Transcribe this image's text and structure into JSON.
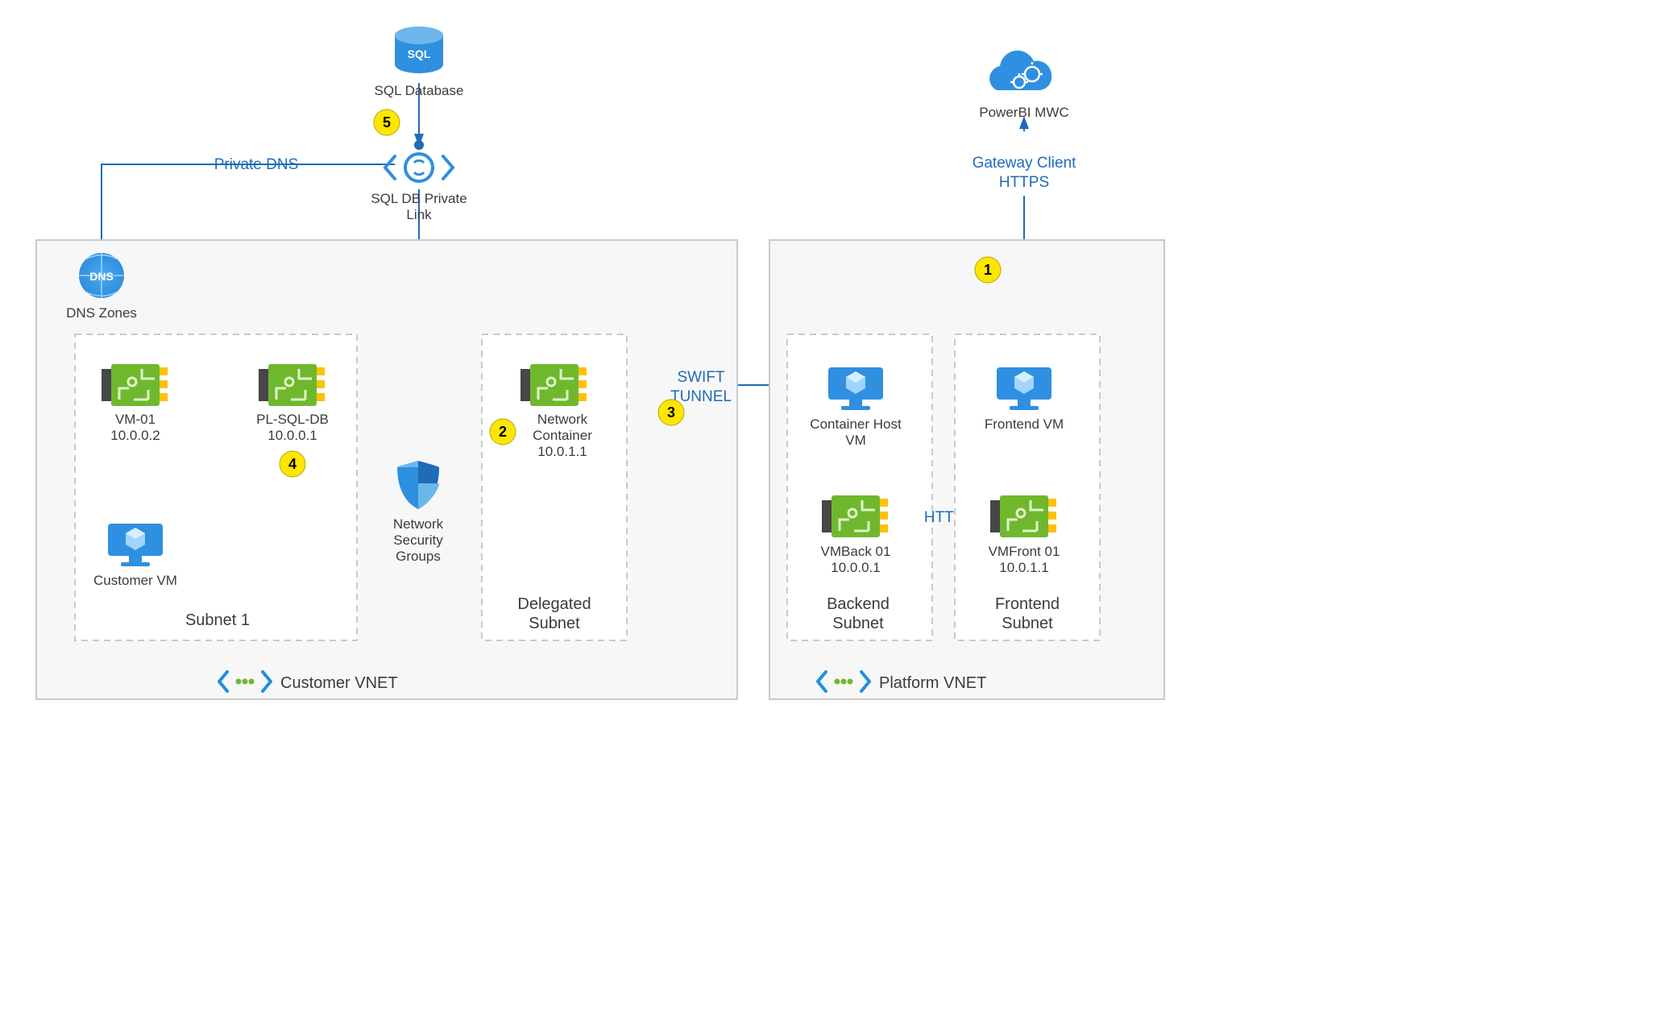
{
  "top": {
    "sql_db_label": "SQL Database",
    "sql_pl_label_1": "SQL DB Private",
    "sql_pl_label_2": "Link",
    "private_dns_label": "Private DNS",
    "powerbi_label": "PowerBI MWC",
    "gw_client_1": "Gateway Client",
    "gw_client_2": "HTTPS"
  },
  "customer_vnet": {
    "title": "Customer VNET",
    "dns_zones_label": "DNS Zones",
    "subnet1": {
      "title": "Subnet 1",
      "vm01_name": "VM-01",
      "vm01_ip": "10.0.0.2",
      "plsql_name": "PL-SQL-DB",
      "plsql_ip": "10.0.0.1",
      "customer_vm_label": "Customer VM"
    },
    "nsg_1": "Network",
    "nsg_2": "Security",
    "nsg_3": "Groups",
    "delegated": {
      "title_1": "Delegated",
      "title_2": "Subnet",
      "nc_name_1": "Network",
      "nc_name_2": "Container",
      "nc_ip": "10.0.1.1"
    }
  },
  "swift_1": "SWIFT",
  "swift_2": "TUNNEL",
  "https_label": "HTTPS",
  "platform_vnet": {
    "title": "Platform VNET",
    "backend": {
      "title_1": "Backend",
      "title_2": "Subnet",
      "host_1": "Container Host",
      "host_2": "VM",
      "vmback_name": "VMBack 01",
      "vmback_ip": "10.0.0.1"
    },
    "frontend": {
      "title_1": "Frontend",
      "title_2": "Subnet",
      "fvm_label": "Frontend VM",
      "vmfront_name": "VMFront 01",
      "vmfront_ip": "10.0.1.1"
    }
  },
  "badges": {
    "b1": "1",
    "b2": "2",
    "b3": "3",
    "b4": "4",
    "b5": "5"
  }
}
